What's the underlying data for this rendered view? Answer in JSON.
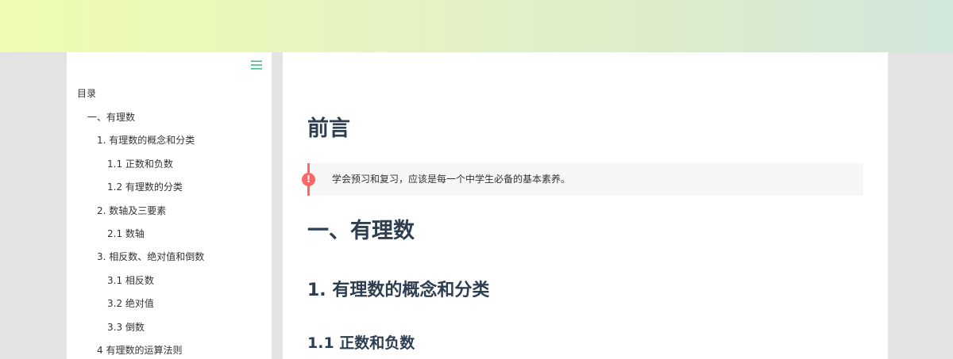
{
  "colors": {
    "accent": "#42b983",
    "heading": "#2c3e50",
    "danger": "#ff6666",
    "callout_bg": "#f6f6f6",
    "page_bg": "#e3e3e3"
  },
  "sidebar": {
    "menu_icon": "menu-icon",
    "toc_title": "目录",
    "items": [
      {
        "label": "一、有理数",
        "level": 1
      },
      {
        "label": "1. 有理数的概念和分类",
        "level": 2
      },
      {
        "label": "1.1 正数和负数",
        "level": 3
      },
      {
        "label": "1.2 有理数的分类",
        "level": 3
      },
      {
        "label": "2. 数轴及三要素",
        "level": 2
      },
      {
        "label": "2.1 数轴",
        "level": 3
      },
      {
        "label": "3. 相反数、绝对值和倒数",
        "level": 2
      },
      {
        "label": "3.1 相反数",
        "level": 3
      },
      {
        "label": "3.2 绝对值",
        "level": 3
      },
      {
        "label": "3.3 倒数",
        "level": 3
      },
      {
        "label": "4 有理数的运算法则",
        "level": 2
      }
    ]
  },
  "content": {
    "preface_heading": "前言",
    "callout": {
      "icon": "exclamation-icon",
      "icon_glyph": "!",
      "text": "学会预习和复习，应该是每一个中学生必备的基本素养。"
    },
    "chapter_heading": "一、有理数",
    "section_heading": "1. 有理数的概念和分类",
    "subsection_heading": "1.1 正数和负数"
  }
}
